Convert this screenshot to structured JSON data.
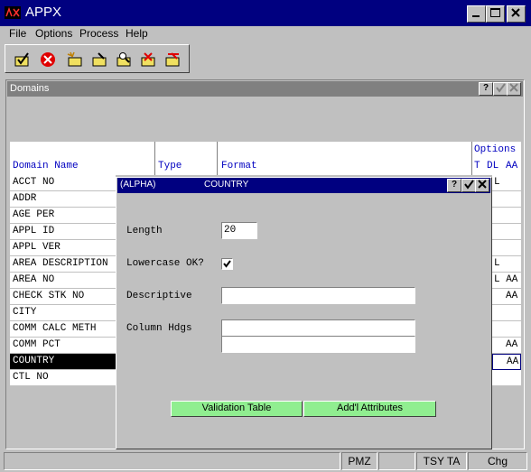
{
  "window": {
    "title": "APPX"
  },
  "menu": {
    "file": "File",
    "options": "Options",
    "process": "Process",
    "help": "Help"
  },
  "domains": {
    "title": "Domains",
    "help_btn": "?",
    "columns": {
      "domain_name": "Domain Name",
      "type": "Type",
      "format": "Format",
      "options": "Options",
      "t": "T",
      "dl": "DL",
      "aa": "AA"
    },
    "rows": [
      {
        "name": "ACCT NO",
        "opt": "L"
      },
      {
        "name": "ADDR",
        "opt": ""
      },
      {
        "name": "AGE PER",
        "opt": ""
      },
      {
        "name": "APPL ID",
        "opt": ""
      },
      {
        "name": "APPL VER",
        "opt": ""
      },
      {
        "name": "AREA DESCRIPTION",
        "opt": "L"
      },
      {
        "name": "AREA NO",
        "opt": "L AA"
      },
      {
        "name": "CHECK STK NO",
        "opt": "AA"
      },
      {
        "name": "CITY",
        "opt": ""
      },
      {
        "name": "COMM CALC METH",
        "opt": ""
      },
      {
        "name": "COMM PCT",
        "opt": "AA"
      },
      {
        "name": "COUNTRY",
        "opt": "AA"
      },
      {
        "name": "CTL NO",
        "opt": ""
      }
    ]
  },
  "dialog": {
    "type_label": "(ALPHA)",
    "title": "COUNTRY",
    "help_btn": "?",
    "length_label": "Length",
    "length_value": "20",
    "lowercase_label": "Lowercase OK?",
    "descriptive_label": "Descriptive",
    "descriptive_value": "",
    "column_hdgs_label": "Column Hdgs",
    "column_hdg_1": "",
    "column_hdg_2": "",
    "validation_button": "Validation Table",
    "addl_button": "Add'l Attributes"
  },
  "status": {
    "pmz": "PMZ",
    "tsy": "TSY TA",
    "chg": "Chg"
  },
  "colors": {
    "title": "#000080",
    "header_text": "#0000c0",
    "green_button": "#90ee90"
  }
}
